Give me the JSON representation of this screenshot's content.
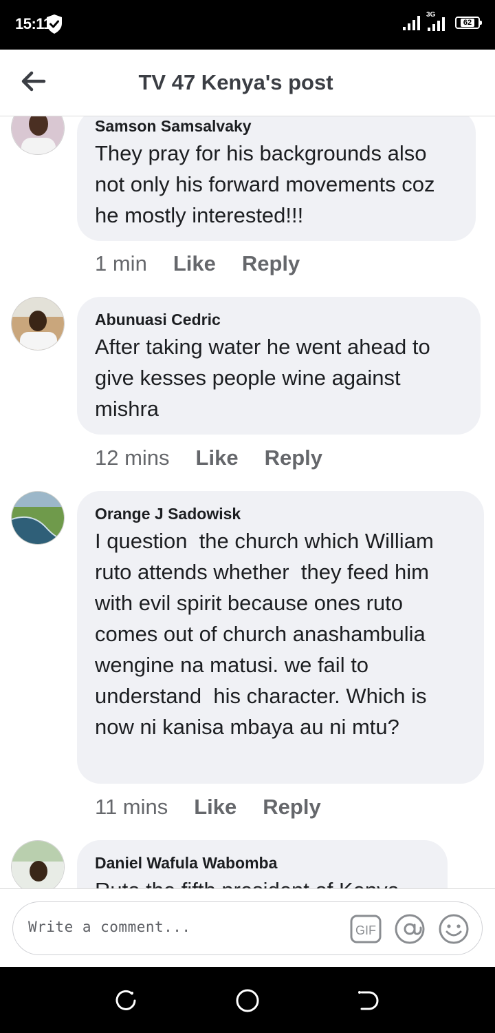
{
  "status_bar": {
    "time": "15:11",
    "network": "3G",
    "battery": "62"
  },
  "header": {
    "title": "TV 47 Kenya's post"
  },
  "comments": [
    {
      "author": "Samson Samsalvaky",
      "text": "They pray for his backgrounds also not only his forward movements coz he mostly interested!!!",
      "time": "1 min",
      "like": "Like",
      "reply": "Reply"
    },
    {
      "author": "Abunuasi Cedric",
      "text": "After taking water he went ahead to give kesses people wine against mishra",
      "time": "12 mins",
      "like": "Like",
      "reply": "Reply"
    },
    {
      "author": "Orange J Sadowisk",
      "text": "I question  the church which William ruto attends whether  they feed him with evil spirit because ones ruto comes out of church anashambulia wengine na matusi. we fail to understand  his character. Which is now ni kanisa mbaya au ni mtu?",
      "time": "11 mins",
      "like": "Like",
      "reply": "Reply"
    },
    {
      "author": "Daniel Wafula Wabomba",
      "text": "Ruto the fifth president of Kenya"
    }
  ],
  "composer": {
    "placeholder": "Write a comment...",
    "gif_label": "GIF"
  },
  "colors": {
    "bubble": "#f0f1f5",
    "text": "#1c1e21",
    "meta": "#65676b"
  }
}
